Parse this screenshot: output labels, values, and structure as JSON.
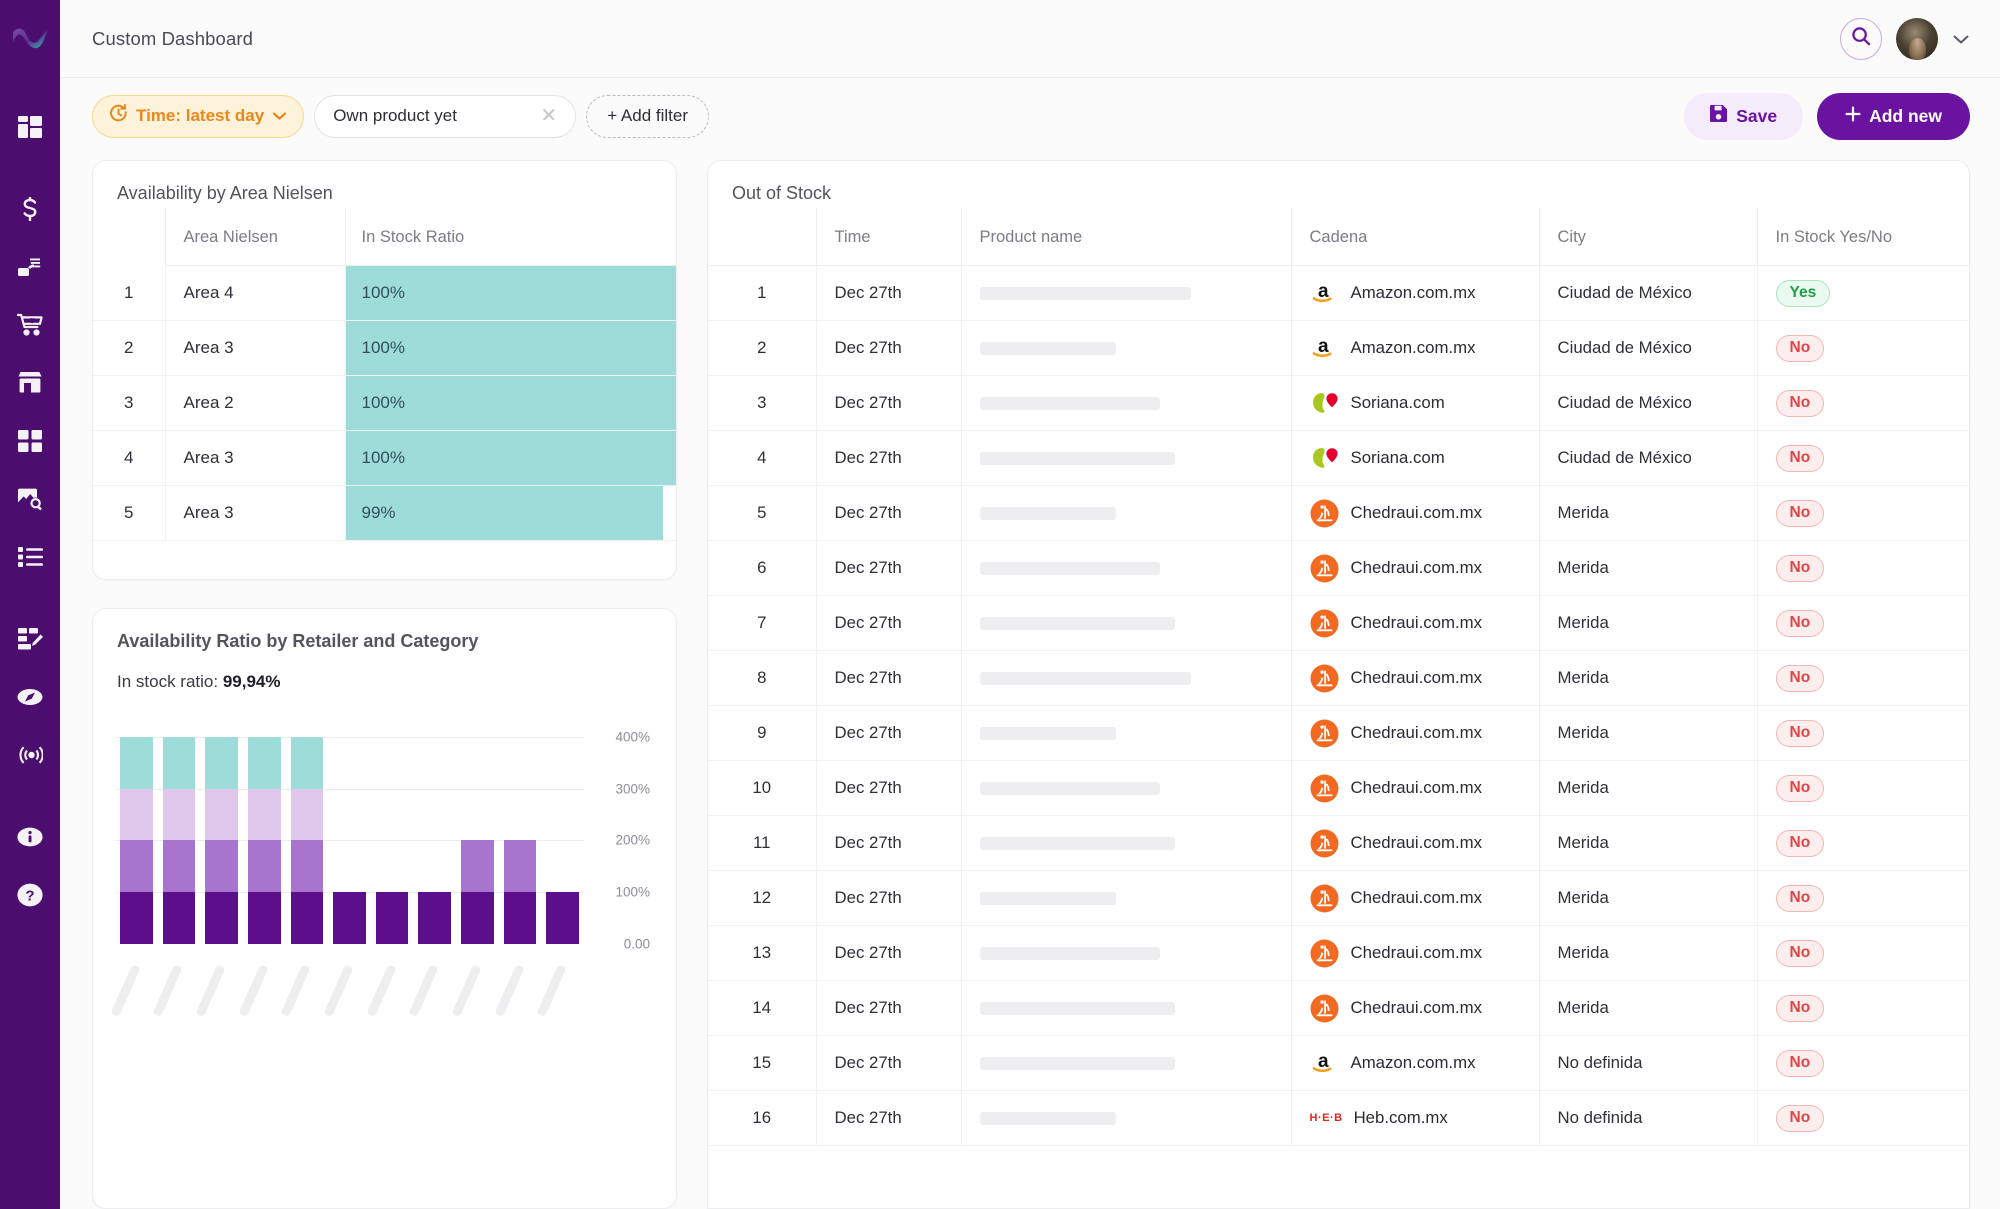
{
  "brand": {
    "primary": "#6a13a0",
    "sidebar_bg": "#4b0d6e",
    "accent_orange": "#e8881b",
    "teal": "#9ddcd8"
  },
  "sidebar": {
    "logo_name": "wavy-logo",
    "items": [
      {
        "name": "dashboard-grid-icon",
        "label": "Dashboard"
      },
      {
        "name": "dollar-icon",
        "label": "Pricing"
      },
      {
        "name": "stack-hand-icon",
        "label": "Assortment"
      },
      {
        "name": "cart-heart-icon",
        "label": "Shopper"
      },
      {
        "name": "store-icon",
        "label": "Retailers"
      },
      {
        "name": "grid-squares-icon",
        "label": "Catalog"
      },
      {
        "name": "image-search-icon",
        "label": "Media"
      },
      {
        "name": "list-icon",
        "label": "Reports"
      },
      {
        "name": "edit-dashboard-icon",
        "label": "Custom Dashboard"
      },
      {
        "name": "compass-icon",
        "label": "Explore"
      },
      {
        "name": "radar-icon",
        "label": "Monitoring"
      },
      {
        "name": "info-icon",
        "label": "Info"
      },
      {
        "name": "help-icon",
        "label": "Help"
      }
    ]
  },
  "header": {
    "title": "Custom Dashboard",
    "search_icon": "search-icon",
    "avatar_name": "user-avatar",
    "caret_icon": "chevron-down-icon"
  },
  "toolbar": {
    "time_chip": {
      "label": "Time: latest day",
      "icon": "clock-refresh-icon",
      "caret": "chevron-down-icon"
    },
    "filter_chip": {
      "value": "Own product yet",
      "clear_icon": "close-icon"
    },
    "add_filter_label": "+ Add filter",
    "save_label": "Save",
    "save_icon": "floppy-disk-icon",
    "add_new_label": "Add new",
    "add_new_icon": "plus-icon"
  },
  "nielsen": {
    "title": "Availability by Area Nielsen",
    "columns": [
      "",
      "Area Nielsen",
      "In Stock Ratio"
    ],
    "rows": [
      {
        "idx": "1",
        "area": "Area 4",
        "ratio": "100%",
        "pct": 100
      },
      {
        "idx": "2",
        "area": "Area 3",
        "ratio": "100%",
        "pct": 100
      },
      {
        "idx": "3",
        "area": "Area 2",
        "ratio": "100%",
        "pct": 100
      },
      {
        "idx": "4",
        "area": "Area 3",
        "ratio": "100%",
        "pct": 100
      },
      {
        "idx": "5",
        "area": "Area 3",
        "ratio": "99%",
        "pct": 96
      }
    ]
  },
  "availability_chart": {
    "title": "Availability Ratio by Retailer and Category",
    "subtitle_label": "In stock ratio:",
    "subtitle_value": "99,94%"
  },
  "chart_data": {
    "type": "bar",
    "stacked": true,
    "title": "Availability Ratio by Retailer and Category",
    "xlabel": "",
    "ylabel": "",
    "ylim": [
      0,
      440
    ],
    "grid": true,
    "legend": "none",
    "ytick_labels": [
      "400%",
      "300%",
      "200%",
      "100%",
      "0.00"
    ],
    "ytick_values": [
      400,
      300,
      200,
      100,
      0
    ],
    "categories": [
      "1",
      "2",
      "3",
      "4",
      "5",
      "6",
      "7",
      "8",
      "9",
      "10",
      "11"
    ],
    "series": [
      {
        "name": "segment-1",
        "color": "#5d0f8b",
        "values": [
          100,
          100,
          100,
          100,
          100,
          100,
          100,
          100,
          100,
          100,
          100
        ]
      },
      {
        "name": "segment-2",
        "color": "#a875ce",
        "values": [
          100,
          100,
          100,
          100,
          100,
          0,
          0,
          0,
          100,
          100,
          0
        ]
      },
      {
        "name": "segment-3",
        "color": "#dec7ea",
        "values": [
          100,
          100,
          100,
          100,
          100,
          0,
          0,
          0,
          0,
          0,
          0
        ]
      },
      {
        "name": "segment-4",
        "color": "#9ddcd8",
        "values": [
          100,
          100,
          100,
          100,
          100,
          0,
          0,
          0,
          0,
          0,
          0
        ]
      }
    ]
  },
  "out_of_stock": {
    "title": "Out of Stock",
    "columns": [
      "",
      "Time",
      "Product name",
      "Cadena",
      "City",
      "In Stock Yes/No"
    ],
    "rows": [
      {
        "idx": "1",
        "time": "Dec 27th",
        "product_w": 68,
        "logo": "amazon-logo",
        "cadena": "Amazon.com.mx",
        "city": "Ciudad de México",
        "stock": "Yes"
      },
      {
        "idx": "2",
        "time": "Dec 27th",
        "product_w": 44,
        "logo": "amazon-logo",
        "cadena": "Amazon.com.mx",
        "city": "Ciudad de México",
        "stock": "No"
      },
      {
        "idx": "3",
        "time": "Dec 27th",
        "product_w": 58,
        "logo": "soriana-logo",
        "cadena": "Soriana.com",
        "city": "Ciudad de México",
        "stock": "No"
      },
      {
        "idx": "4",
        "time": "Dec 27th",
        "product_w": 63,
        "logo": "soriana-logo",
        "cadena": "Soriana.com",
        "city": "Ciudad de México",
        "stock": "No"
      },
      {
        "idx": "5",
        "time": "Dec 27th",
        "product_w": 44,
        "logo": "chedraui-logo",
        "cadena": "Chedraui.com.mx",
        "city": "Merida",
        "stock": "No"
      },
      {
        "idx": "6",
        "time": "Dec 27th",
        "product_w": 58,
        "logo": "chedraui-logo",
        "cadena": "Chedraui.com.mx",
        "city": "Merida",
        "stock": "No"
      },
      {
        "idx": "7",
        "time": "Dec 27th",
        "product_w": 63,
        "logo": "chedraui-logo",
        "cadena": "Chedraui.com.mx",
        "city": "Merida",
        "stock": "No"
      },
      {
        "idx": "8",
        "time": "Dec 27th",
        "product_w": 68,
        "logo": "chedraui-logo",
        "cadena": "Chedraui.com.mx",
        "city": "Merida",
        "stock": "No"
      },
      {
        "idx": "9",
        "time": "Dec 27th",
        "product_w": 44,
        "logo": "chedraui-logo",
        "cadena": "Chedraui.com.mx",
        "city": "Merida",
        "stock": "No"
      },
      {
        "idx": "10",
        "time": "Dec 27th",
        "product_w": 58,
        "logo": "chedraui-logo",
        "cadena": "Chedraui.com.mx",
        "city": "Merida",
        "stock": "No"
      },
      {
        "idx": "11",
        "time": "Dec 27th",
        "product_w": 63,
        "logo": "chedraui-logo",
        "cadena": "Chedraui.com.mx",
        "city": "Merida",
        "stock": "No"
      },
      {
        "idx": "12",
        "time": "Dec 27th",
        "product_w": 44,
        "logo": "chedraui-logo",
        "cadena": "Chedraui.com.mx",
        "city": "Merida",
        "stock": "No"
      },
      {
        "idx": "13",
        "time": "Dec 27th",
        "product_w": 58,
        "logo": "chedraui-logo",
        "cadena": "Chedraui.com.mx",
        "city": "Merida",
        "stock": "No"
      },
      {
        "idx": "14",
        "time": "Dec 27th",
        "product_w": 63,
        "logo": "chedraui-logo",
        "cadena": "Chedraui.com.mx",
        "city": "Merida",
        "stock": "No"
      },
      {
        "idx": "15",
        "time": "Dec 27th",
        "product_w": 63,
        "logo": "amazon-logo",
        "cadena": "Amazon.com.mx",
        "city": "No definida",
        "stock": "No"
      },
      {
        "idx": "16",
        "time": "Dec 27th",
        "product_w": 44,
        "logo": "heb-logo",
        "cadena": "Heb.com.mx",
        "city": "No definida",
        "stock": "No"
      }
    ]
  }
}
